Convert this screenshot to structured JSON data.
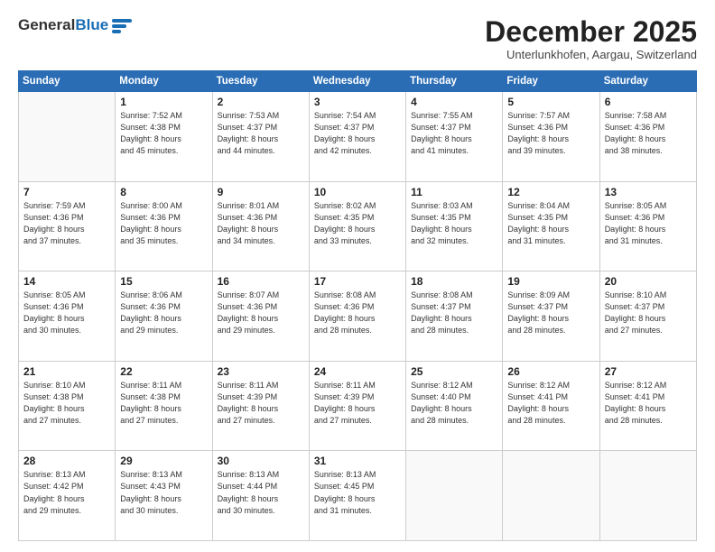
{
  "header": {
    "logo_general": "General",
    "logo_blue": "Blue",
    "month_title": "December 2025",
    "location": "Unterlunkhofen, Aargau, Switzerland"
  },
  "calendar": {
    "days_of_week": [
      "Sunday",
      "Monday",
      "Tuesday",
      "Wednesday",
      "Thursday",
      "Friday",
      "Saturday"
    ],
    "weeks": [
      [
        {
          "day": "",
          "info": ""
        },
        {
          "day": "1",
          "info": "Sunrise: 7:52 AM\nSunset: 4:38 PM\nDaylight: 8 hours\nand 45 minutes."
        },
        {
          "day": "2",
          "info": "Sunrise: 7:53 AM\nSunset: 4:37 PM\nDaylight: 8 hours\nand 44 minutes."
        },
        {
          "day": "3",
          "info": "Sunrise: 7:54 AM\nSunset: 4:37 PM\nDaylight: 8 hours\nand 42 minutes."
        },
        {
          "day": "4",
          "info": "Sunrise: 7:55 AM\nSunset: 4:37 PM\nDaylight: 8 hours\nand 41 minutes."
        },
        {
          "day": "5",
          "info": "Sunrise: 7:57 AM\nSunset: 4:36 PM\nDaylight: 8 hours\nand 39 minutes."
        },
        {
          "day": "6",
          "info": "Sunrise: 7:58 AM\nSunset: 4:36 PM\nDaylight: 8 hours\nand 38 minutes."
        }
      ],
      [
        {
          "day": "7",
          "info": "Sunrise: 7:59 AM\nSunset: 4:36 PM\nDaylight: 8 hours\nand 37 minutes."
        },
        {
          "day": "8",
          "info": "Sunrise: 8:00 AM\nSunset: 4:36 PM\nDaylight: 8 hours\nand 35 minutes."
        },
        {
          "day": "9",
          "info": "Sunrise: 8:01 AM\nSunset: 4:36 PM\nDaylight: 8 hours\nand 34 minutes."
        },
        {
          "day": "10",
          "info": "Sunrise: 8:02 AM\nSunset: 4:35 PM\nDaylight: 8 hours\nand 33 minutes."
        },
        {
          "day": "11",
          "info": "Sunrise: 8:03 AM\nSunset: 4:35 PM\nDaylight: 8 hours\nand 32 minutes."
        },
        {
          "day": "12",
          "info": "Sunrise: 8:04 AM\nSunset: 4:35 PM\nDaylight: 8 hours\nand 31 minutes."
        },
        {
          "day": "13",
          "info": "Sunrise: 8:05 AM\nSunset: 4:36 PM\nDaylight: 8 hours\nand 31 minutes."
        }
      ],
      [
        {
          "day": "14",
          "info": "Sunrise: 8:05 AM\nSunset: 4:36 PM\nDaylight: 8 hours\nand 30 minutes."
        },
        {
          "day": "15",
          "info": "Sunrise: 8:06 AM\nSunset: 4:36 PM\nDaylight: 8 hours\nand 29 minutes."
        },
        {
          "day": "16",
          "info": "Sunrise: 8:07 AM\nSunset: 4:36 PM\nDaylight: 8 hours\nand 29 minutes."
        },
        {
          "day": "17",
          "info": "Sunrise: 8:08 AM\nSunset: 4:36 PM\nDaylight: 8 hours\nand 28 minutes."
        },
        {
          "day": "18",
          "info": "Sunrise: 8:08 AM\nSunset: 4:37 PM\nDaylight: 8 hours\nand 28 minutes."
        },
        {
          "day": "19",
          "info": "Sunrise: 8:09 AM\nSunset: 4:37 PM\nDaylight: 8 hours\nand 28 minutes."
        },
        {
          "day": "20",
          "info": "Sunrise: 8:10 AM\nSunset: 4:37 PM\nDaylight: 8 hours\nand 27 minutes."
        }
      ],
      [
        {
          "day": "21",
          "info": "Sunrise: 8:10 AM\nSunset: 4:38 PM\nDaylight: 8 hours\nand 27 minutes."
        },
        {
          "day": "22",
          "info": "Sunrise: 8:11 AM\nSunset: 4:38 PM\nDaylight: 8 hours\nand 27 minutes."
        },
        {
          "day": "23",
          "info": "Sunrise: 8:11 AM\nSunset: 4:39 PM\nDaylight: 8 hours\nand 27 minutes."
        },
        {
          "day": "24",
          "info": "Sunrise: 8:11 AM\nSunset: 4:39 PM\nDaylight: 8 hours\nand 27 minutes."
        },
        {
          "day": "25",
          "info": "Sunrise: 8:12 AM\nSunset: 4:40 PM\nDaylight: 8 hours\nand 28 minutes."
        },
        {
          "day": "26",
          "info": "Sunrise: 8:12 AM\nSunset: 4:41 PM\nDaylight: 8 hours\nand 28 minutes."
        },
        {
          "day": "27",
          "info": "Sunrise: 8:12 AM\nSunset: 4:41 PM\nDaylight: 8 hours\nand 28 minutes."
        }
      ],
      [
        {
          "day": "28",
          "info": "Sunrise: 8:13 AM\nSunset: 4:42 PM\nDaylight: 8 hours\nand 29 minutes."
        },
        {
          "day": "29",
          "info": "Sunrise: 8:13 AM\nSunset: 4:43 PM\nDaylight: 8 hours\nand 30 minutes."
        },
        {
          "day": "30",
          "info": "Sunrise: 8:13 AM\nSunset: 4:44 PM\nDaylight: 8 hours\nand 30 minutes."
        },
        {
          "day": "31",
          "info": "Sunrise: 8:13 AM\nSunset: 4:45 PM\nDaylight: 8 hours\nand 31 minutes."
        },
        {
          "day": "",
          "info": ""
        },
        {
          "day": "",
          "info": ""
        },
        {
          "day": "",
          "info": ""
        }
      ]
    ]
  }
}
